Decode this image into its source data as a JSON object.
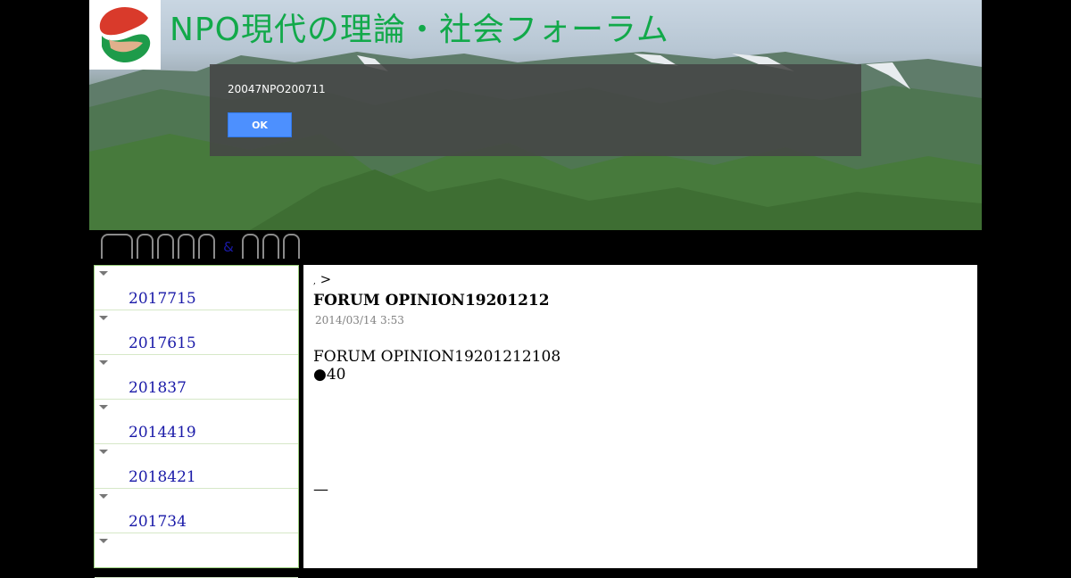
{
  "header": {
    "site_title": "NPO現代の理論・社会フォーラム"
  },
  "dialog": {
    "message": "20047NPO200711",
    "ok_label": "OK"
  },
  "nav": {
    "amp_label": "&"
  },
  "sidebar": {
    "items": [
      {
        "label": "2017715"
      },
      {
        "label": "2017615"
      },
      {
        "label": "201837"
      },
      {
        "label": "2014419"
      },
      {
        "label": "2018421"
      },
      {
        "label": "201734"
      },
      {
        "label": ""
      }
    ]
  },
  "post": {
    "breadcrumb_dot": ",",
    "breadcrumb_sep": ">",
    "title": "FORUM OPINION19201212",
    "date": "2014/03/14 3:53",
    "body_line1": "FORUM OPINION19201212108",
    "body_line2": "●40",
    "dash": "—"
  },
  "colors": {
    "title_green": "#12a94a",
    "link_blue": "#1a1aa8",
    "ok_blue": "#4d90fe",
    "sidebar_border": "#9ccf7e"
  }
}
